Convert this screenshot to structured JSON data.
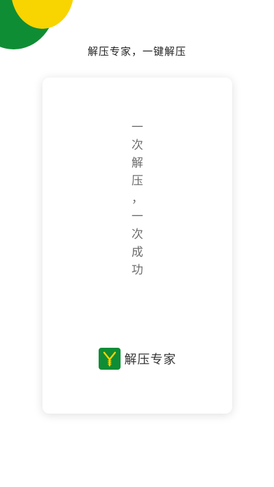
{
  "header": {
    "tagline": "解压专家，一键解压"
  },
  "card": {
    "slogan_chars": [
      "一",
      "次",
      "解",
      "压",
      "，",
      "一",
      "次",
      "成",
      "功"
    ],
    "brand_name": "解压专家",
    "logo_icon": "zipper-y-icon"
  },
  "colors": {
    "brand_green": "#0f8d35",
    "accent_yellow": "#f8d400",
    "slogan_gray": "#6c6c6c"
  }
}
